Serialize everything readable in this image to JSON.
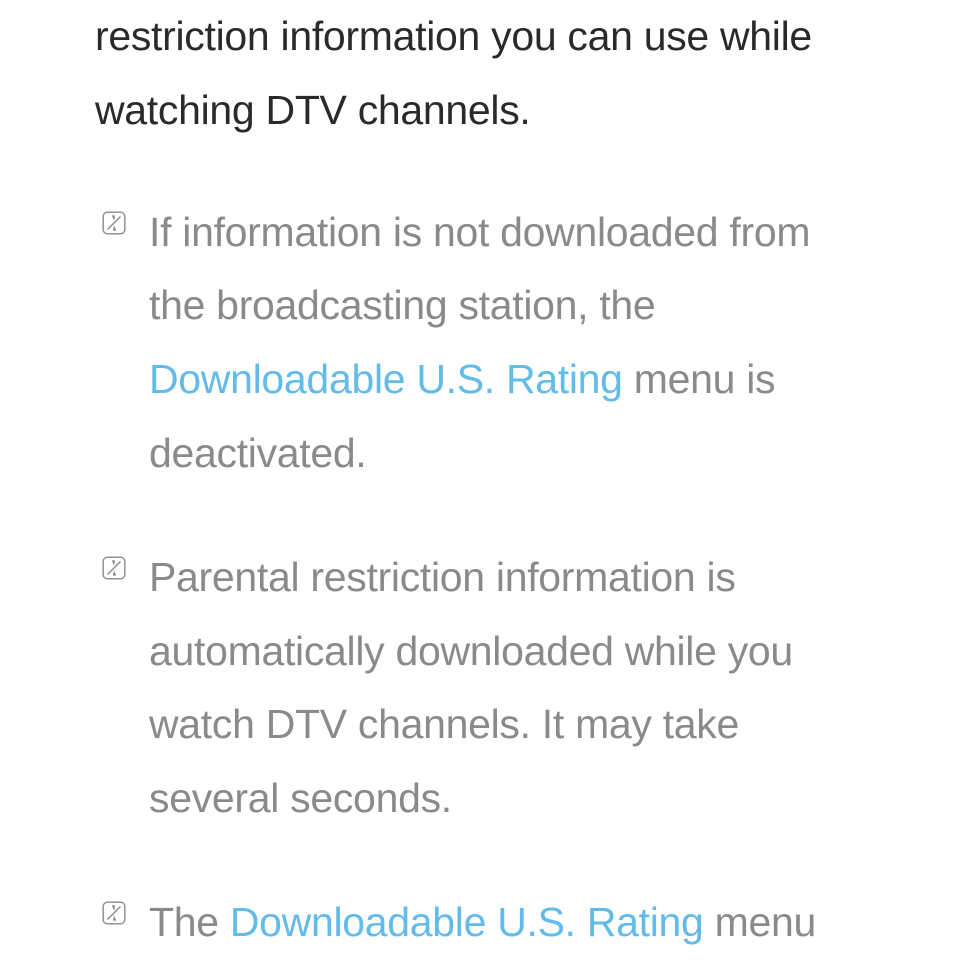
{
  "intro": "restriction information you can use while watching DTV channels.",
  "notes": [
    {
      "segments": [
        {
          "text": "If information is not downloaded from the broadcasting station, the ",
          "highlight": false
        },
        {
          "text": "Downloadable U.S. Rating",
          "highlight": true
        },
        {
          "text": " menu is deactivated.",
          "highlight": false
        }
      ]
    },
    {
      "segments": [
        {
          "text": "Parental restriction information is automatically downloaded while you watch DTV channels. It may take several seconds.",
          "highlight": false
        }
      ]
    },
    {
      "segments": [
        {
          "text": "The ",
          "highlight": false
        },
        {
          "text": "Downloadable U.S. Rating",
          "highlight": true
        },
        {
          "text": " menu",
          "highlight": false
        }
      ]
    }
  ]
}
